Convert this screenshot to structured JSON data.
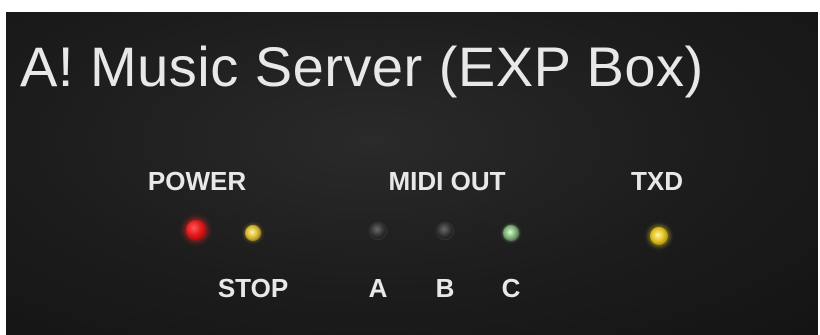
{
  "panel": {
    "title": "A! Music Server (EXP Box)",
    "labels": {
      "power": "POWER",
      "midi_out": "MIDI OUT",
      "txd": "TXD",
      "stop": "STOP",
      "a": "A",
      "b": "B",
      "c": "C"
    }
  },
  "colors": {
    "panel_background": "#1c1c1c",
    "text": "#e8e8e8",
    "power_led": "#e01818",
    "stop_led": "#d8b830",
    "midi_led_off": "#2c2c2c",
    "midi_c_led": "#7fb07a",
    "txd_led": "#e0c020"
  }
}
